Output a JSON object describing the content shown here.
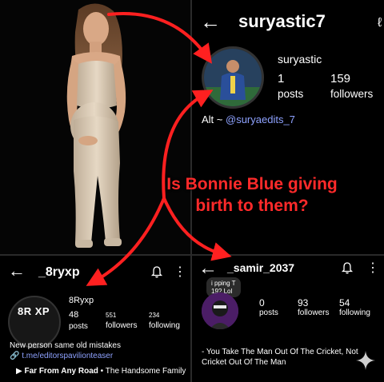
{
  "profile_top_right": {
    "handle": "suryastic7",
    "partial_icon": "ℓ",
    "name": "suryastic",
    "posts_count": "1",
    "posts_label": "posts",
    "followers_count": "159",
    "followers_label": "followers",
    "bio_prefix": "Alt ~ ",
    "bio_link": "@suryaedits_7"
  },
  "profile_bottom_left": {
    "handle": "_8ryxp",
    "avatar_text": "8R  XP",
    "name": "8Ryxp",
    "posts_count": "48",
    "posts_label": "posts",
    "followers_count": "551",
    "followers_label": "followers",
    "following_count": "234",
    "following_label": "following",
    "bio": "New person same old mistakes",
    "link": "t.me/editorspavilionteaser",
    "music_title": "Far From Any Road",
    "music_sep": " • ",
    "music_artist": "The Handsome Family"
  },
  "profile_bottom_right": {
    "handle": "_samir_2037",
    "note": "i pping T\n19? Lol",
    "posts_count": "0",
    "posts_label": "posts",
    "followers_count": "93",
    "followers_label": "followers",
    "following_count": "54",
    "following_label": "following",
    "bio": "- You Take The Man Out Of The Cricket, Not Cricket Out Of The Man"
  },
  "caption": {
    "line1": "Is Bonnie Blue giving",
    "line2": "birth to them?"
  },
  "icons": {
    "back": "arrow-left-icon",
    "bell": "bell-icon",
    "more": "more-vertical-icon",
    "link": "link-icon",
    "play": "play-circle-icon",
    "sparkle": "sparkle-icon"
  },
  "colors": {
    "background": "#000000",
    "accent_red": "#ff2a2a",
    "link_blue": "#8ea2ff"
  }
}
